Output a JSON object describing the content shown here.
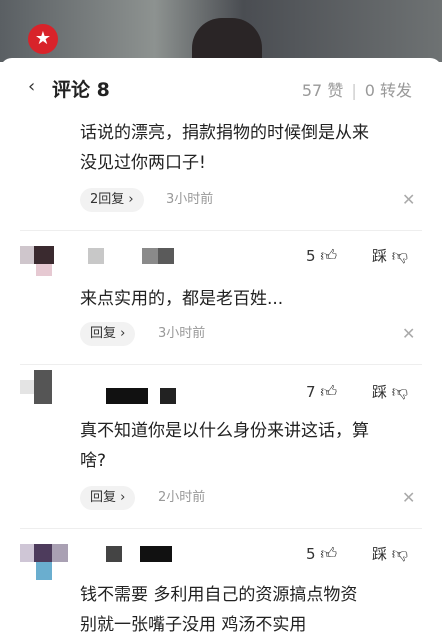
{
  "header": {
    "title": "评论 8",
    "likes": "57 赞",
    "reposts": "0 转发"
  },
  "comments": [
    {
      "text_lines": [
        "话说的漂亮，捐款捐物的时候倒是从来",
        "没见过你两口子!"
      ],
      "reply_label": "2回复 ›",
      "time": "3小时前"
    },
    {
      "likes": "5",
      "dislike_label": "踩",
      "text_lines": [
        "来点实用的，都是老百姓..."
      ],
      "reply_label": "回复 ›",
      "time": "3小时前"
    },
    {
      "likes": "7",
      "dislike_label": "踩",
      "text_lines": [
        "真不知道你是以什么身份来讲这话，算",
        "啥?"
      ],
      "reply_label": "回复 ›",
      "time": "2小时前"
    },
    {
      "likes": "5",
      "dislike_label": "踩",
      "text_lines": [
        "钱不需要 多利用自己的资源搞点物资",
        "别就一张嘴子没用 鸡汤不实用"
      ]
    }
  ],
  "colors": {
    "brand": "#d8232a",
    "muted": "#999999",
    "chip": "#f2f2f2"
  },
  "icons": [
    "channel-logo-icon",
    "back-icon",
    "thumb-up-icon",
    "thumb-down-icon",
    "close-icon"
  ]
}
